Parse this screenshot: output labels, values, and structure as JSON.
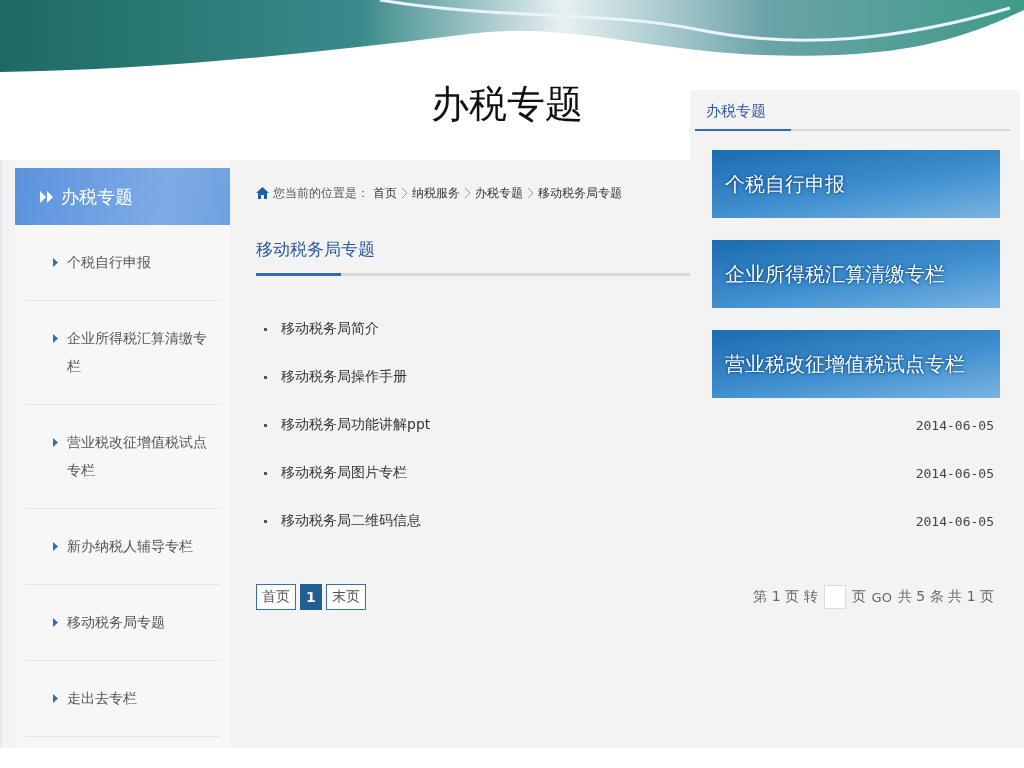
{
  "slide_title": "办税专题",
  "sidebar": {
    "header": "办税专题",
    "items": [
      {
        "label": "个税自行申报"
      },
      {
        "label": "企业所得税汇算清缴专栏"
      },
      {
        "label": "营业税改征增值税试点专栏"
      },
      {
        "label": "新办纳税人辅导专栏"
      },
      {
        "label": "移动税务局专题"
      },
      {
        "label": "走出去专栏"
      }
    ]
  },
  "breadcrumb": {
    "prefix": "您当前的位置是：",
    "items": [
      "首页",
      "纳税服务",
      "办税专题",
      "移动税务局专题"
    ]
  },
  "section_title": "移动税务局专题",
  "articles": [
    {
      "title": "移动税务局简介"
    },
    {
      "title": "移动税务局操作手册"
    },
    {
      "title": "移动税务局功能讲解ppt",
      "date": "2014-06-05"
    },
    {
      "title": "移动税务局图片专栏",
      "date": "2014-06-05"
    },
    {
      "title": "移动税务局二维码信息",
      "date": "2014-06-05"
    }
  ],
  "pagination": {
    "pages": [
      {
        "label": "首页",
        "selected": false
      },
      {
        "label": "1",
        "selected": true
      },
      {
        "label": "末页",
        "selected": false
      }
    ],
    "info_before": "第 1 页 转",
    "info_mid": "页",
    "go": "GO",
    "info_after": "共 5 条 共 1 页"
  },
  "side_panel": {
    "title": "办税专题",
    "banners": [
      "个税自行申报",
      "企业所得税汇算清缴专栏",
      "营业税改征增值税试点专栏"
    ]
  }
}
